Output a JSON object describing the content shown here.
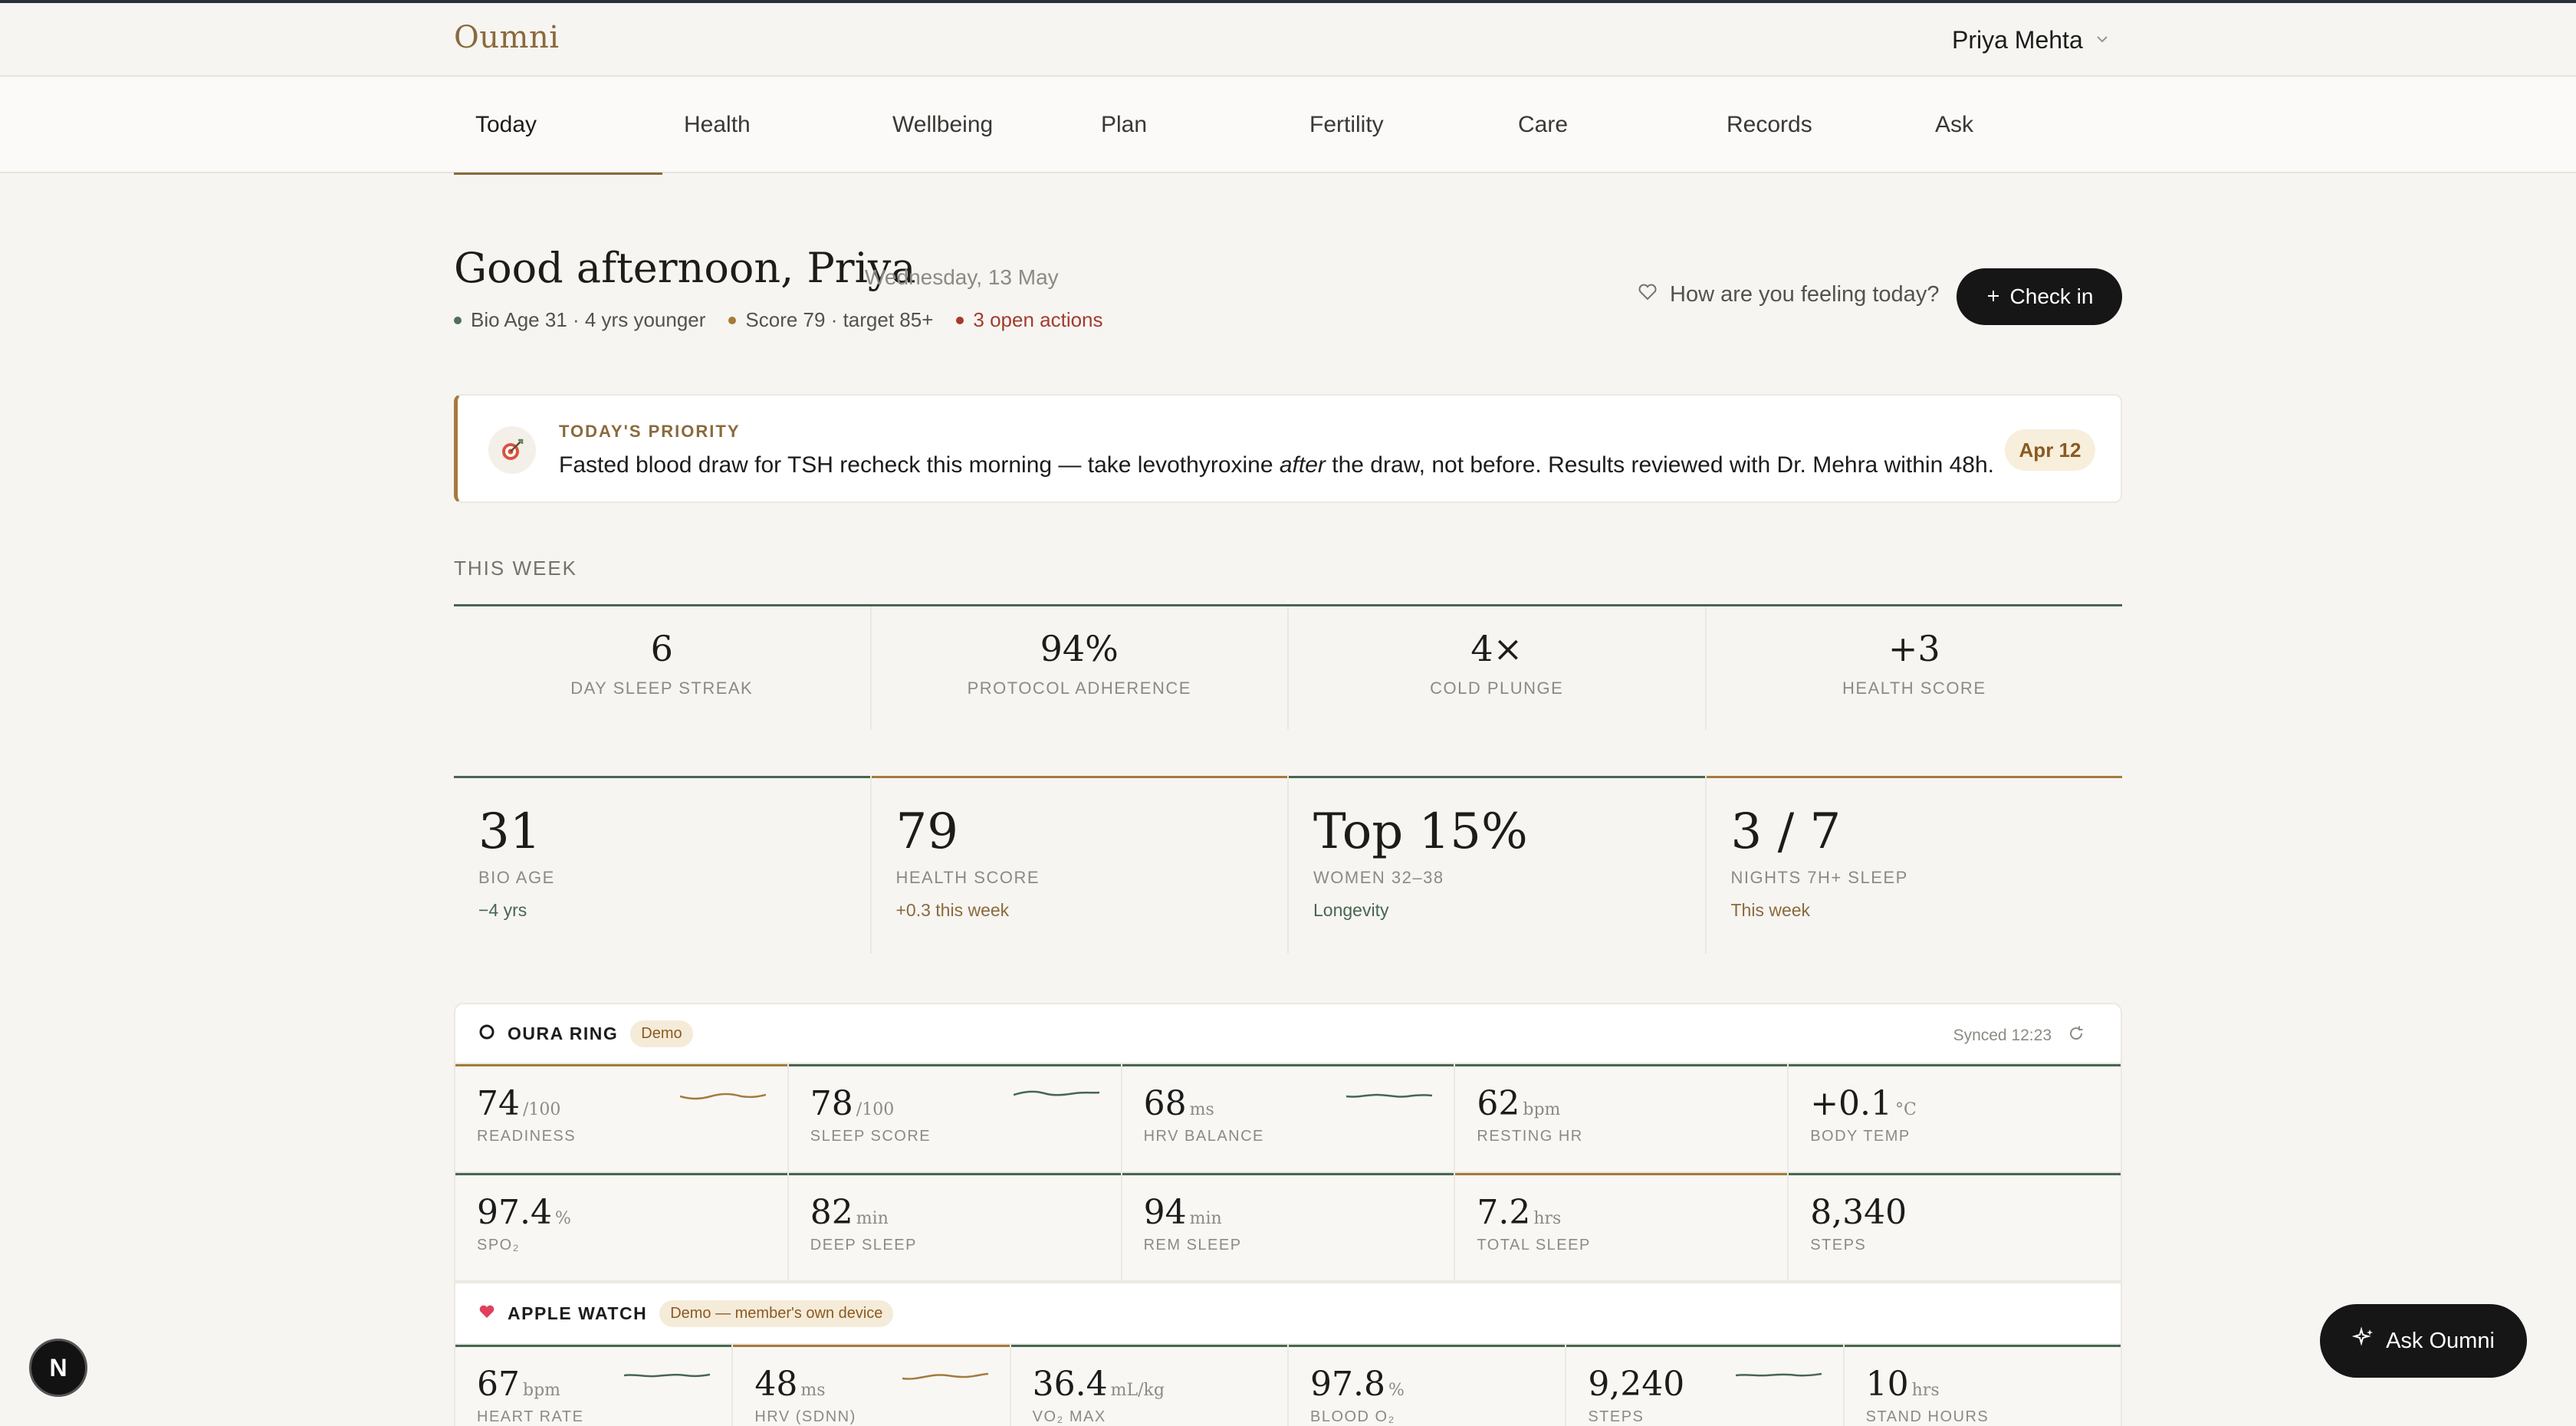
{
  "app": {
    "brand": "Oumni",
    "user_name": "Priya Mehta"
  },
  "nav": {
    "items": [
      {
        "label": "Today",
        "active": true
      },
      {
        "label": "Health",
        "active": false
      },
      {
        "label": "Wellbeing",
        "active": false
      },
      {
        "label": "Plan",
        "active": false
      },
      {
        "label": "Fertility",
        "active": false
      },
      {
        "label": "Care",
        "active": false
      },
      {
        "label": "Records",
        "active": false
      },
      {
        "label": "Ask",
        "active": false
      }
    ]
  },
  "header": {
    "greeting": "Good afternoon, Priya",
    "date": "Wednesday, 13 May",
    "meta": [
      {
        "text": "Bio Age 31 · 4 yrs younger",
        "color": "#4f6f57",
        "text_color": "#55524c"
      },
      {
        "text": "Score 79 · target 85+",
        "color": "#a57a3d",
        "text_color": "#55524c"
      },
      {
        "text": "3 open actions",
        "color": "#a23c2c",
        "text_color": "#a23c2c"
      }
    ],
    "feel_prompt": "How are you feeling today?",
    "checkin_label": "Check in",
    "checkin_icon": "plus-icon",
    "feel_icon": "heart-outline-icon"
  },
  "priority": {
    "label": "TODAY'S PRIORITY",
    "icon": "target-icon",
    "text_before": "Fasted blood draw for TSH recheck this morning — take levothyroxine ",
    "text_em": "after",
    "text_after": " the draw, not before. Results reviewed with Dr. Mehra within 48h.",
    "date": "Apr 12"
  },
  "this_week": {
    "label": "THIS WEEK",
    "items": [
      {
        "value": "6",
        "label": "DAY SLEEP STREAK"
      },
      {
        "value": "94%",
        "label": "PROTOCOL ADHERENCE"
      },
      {
        "value": "4×",
        "label": "COLD PLUNGE"
      },
      {
        "value": "+3",
        "label": "HEALTH SCORE"
      }
    ]
  },
  "stats": [
    {
      "value": "31",
      "label": "BIO AGE",
      "sub": "−4 yrs",
      "bar": "#486650",
      "sub_color": "#486650"
    },
    {
      "value": "79",
      "label": "HEALTH SCORE",
      "sub": "+0.3 this week",
      "bar": "#a57a3d",
      "sub_color": "#8a6a3c"
    },
    {
      "value": "Top 15%",
      "label": "WOMEN 32–38",
      "sub": "Longevity",
      "bar": "#486650",
      "sub_color": "#486650"
    },
    {
      "value": "3 / 7",
      "label": "NIGHTS 7H+ SLEEP",
      "sub": "This week",
      "bar": "#a57a3d",
      "sub_color": "#8a6a3c"
    }
  ],
  "oura": {
    "name": "OURA RING",
    "badge": "Demo",
    "icon": "ring-icon",
    "synced": "Synced 12:23",
    "refresh_icon": "refresh-icon",
    "rows": [
      [
        {
          "value": "74",
          "unit": "/100",
          "label": "READINESS",
          "bar": "#a57a3d",
          "spark": "#a57a3d"
        },
        {
          "value": "78",
          "unit": "/100",
          "label": "SLEEP SCORE",
          "bar": "#486650",
          "spark": "#486650"
        },
        {
          "value": "68",
          "unit": "ms",
          "label": "HRV BALANCE",
          "bar": "#486650",
          "spark": "#486650"
        },
        {
          "value": "62",
          "unit": "bpm",
          "label": "RESTING HR",
          "bar": "#486650",
          "spark": ""
        },
        {
          "value": "+0.1",
          "unit": "°C",
          "label": "BODY TEMP",
          "bar": "#486650",
          "spark": ""
        }
      ],
      [
        {
          "value": "97.4",
          "unit": "%",
          "label": "SPO₂",
          "bar": "#486650",
          "spark": ""
        },
        {
          "value": "82",
          "unit": "min",
          "label": "DEEP SLEEP",
          "bar": "#486650",
          "spark": ""
        },
        {
          "value": "94",
          "unit": "min",
          "label": "REM SLEEP",
          "bar": "#486650",
          "spark": ""
        },
        {
          "value": "7.2",
          "unit": "hrs",
          "label": "TOTAL SLEEP",
          "bar": "#a57a3d",
          "spark": ""
        },
        {
          "value": "8,340",
          "unit": "",
          "label": "STEPS",
          "bar": "#486650",
          "spark": ""
        }
      ]
    ]
  },
  "apple": {
    "name": "APPLE WATCH",
    "badge": "Demo — member's own device",
    "icon": "heart-icon",
    "rows": [
      [
        {
          "value": "67",
          "unit": "bpm",
          "label": "HEART RATE",
          "bar": "#486650",
          "spark": "#486650"
        },
        {
          "value": "48",
          "unit": "ms",
          "label": "HRV (SDNN)",
          "bar": "#a57a3d",
          "spark": "#a57a3d"
        },
        {
          "value": "36.4",
          "unit": "mL/kg",
          "label": "VO₂ MAX",
          "bar": "#486650",
          "spark": ""
        },
        {
          "value": "97.8",
          "unit": "%",
          "label": "BLOOD O₂",
          "bar": "#486650",
          "spark": ""
        },
        {
          "value": "9,240",
          "unit": "",
          "label": "STEPS",
          "bar": "#486650",
          "spark": "#486650"
        },
        {
          "value": "10",
          "unit": "hrs",
          "label": "STAND HOURS",
          "bar": "#486650",
          "spark": ""
        }
      ]
    ]
  },
  "ask_button": {
    "label": "Ask Oumni",
    "icon": "sparkle-icon"
  },
  "dev_badge": {
    "label": "N"
  }
}
